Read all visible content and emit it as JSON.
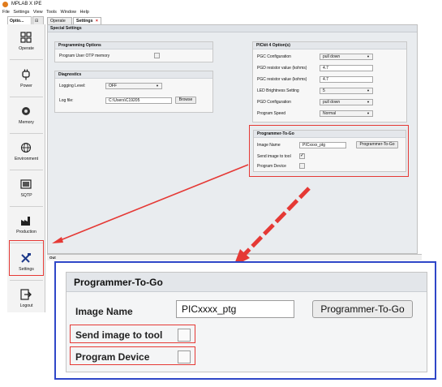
{
  "window": {
    "title": "MPLAB X IPE"
  },
  "menu": [
    "File",
    "Settings",
    "View",
    "Tools",
    "Window",
    "Help"
  ],
  "side_tabs": [
    {
      "label": "Optio...",
      "active": true
    },
    {
      "label": "⊟",
      "active": false
    }
  ],
  "sidebar": {
    "items": [
      {
        "label": "Operate",
        "icon": "grid-icon"
      },
      {
        "label": "Power",
        "icon": "power-plug-icon"
      },
      {
        "label": "Memory",
        "icon": "memory-chip-icon"
      },
      {
        "label": "Environment",
        "icon": "globe-icon"
      },
      {
        "label": "SQTP",
        "icon": "sqtp-chip-icon"
      },
      {
        "label": "Production",
        "icon": "factory-icon"
      },
      {
        "label": "Settings",
        "icon": "tools-icon",
        "highlighted": true
      },
      {
        "label": "Logout",
        "icon": "logout-icon"
      }
    ]
  },
  "doc_tabs": [
    {
      "label": "Operate",
      "active": false
    },
    {
      "label": "Settings",
      "active": true,
      "close": "×"
    }
  ],
  "special_settings": {
    "header": "Special Settings"
  },
  "programming_options": {
    "title": "Programming Options",
    "otp_label": "Program User OTP memory"
  },
  "diagnostics": {
    "title": "Diagnostics",
    "logging_label": "Logging Level:",
    "logging_value": "OFF",
    "logfile_label": "Log file:",
    "logfile_value": "C:\\Users\\C19205",
    "browse_label": "Browse"
  },
  "pickit": {
    "title": "PICkit 4 Option(s)",
    "rows": [
      {
        "label": "PGC Configuration",
        "value": "pull down",
        "kind": "select"
      },
      {
        "label": "PGD resistor value (kohms)",
        "value": "4.7",
        "kind": "text"
      },
      {
        "label": "PGC resistor value (kohms)",
        "value": "4.7",
        "kind": "text"
      },
      {
        "label": "LED Brightness Setting",
        "value": "5",
        "kind": "select"
      },
      {
        "label": "PGD Configuration",
        "value": "pull down",
        "kind": "select"
      },
      {
        "label": "Program Speed",
        "value": "Normal",
        "kind": "select"
      }
    ]
  },
  "ptg_small": {
    "title": "Programmer-To-Go",
    "image_label": "Image Name",
    "image_value": "PICxxxx_ptg",
    "button_label": "Programmer-To-Go",
    "send_label": "Send image to tool",
    "send_checked": true,
    "program_label": "Program Device",
    "program_checked": false
  },
  "output": {
    "label": "Out"
  },
  "zoom": {
    "title": "Programmer-To-Go",
    "image_label": "Image Name",
    "image_value": "PICxxxx_ptg",
    "button_label": "Programmer-To-Go",
    "send_label": "Send image to tool",
    "program_label": "Program Device"
  },
  "colors": {
    "highlight_red": "#e53935",
    "callout_blue": "#2f47c8"
  }
}
